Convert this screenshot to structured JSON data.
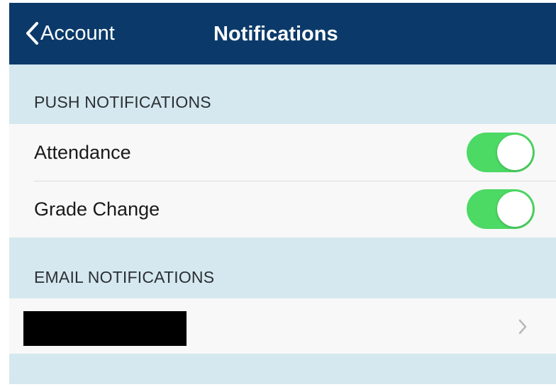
{
  "nav": {
    "back_label": "Account",
    "title": "Notifications",
    "background": "#0b3a6a"
  },
  "push": {
    "header": "PUSH NOTIFICATIONS",
    "items": [
      {
        "label": "Attendance",
        "enabled": true
      },
      {
        "label": "Grade Change",
        "enabled": true
      }
    ],
    "toggle_color": "#4cd964"
  },
  "email": {
    "header": "EMAIL NOTIFICATIONS"
  },
  "icons": {
    "back": "chevron-left-icon",
    "disclosure": "chevron-right-icon"
  }
}
